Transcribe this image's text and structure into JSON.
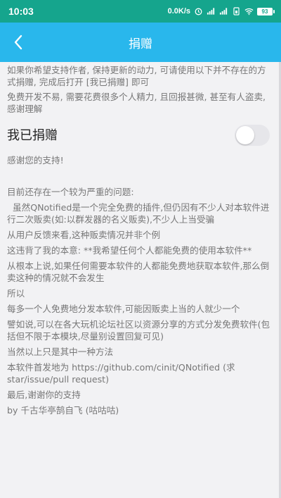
{
  "status_bar": {
    "time": "10:03",
    "speed": "0.0K/s",
    "battery": "93"
  },
  "app_bar": {
    "title": "捐赠",
    "back_icon": "chevron-left-icon"
  },
  "intro": [
    "如果你希望支持作者, 保持更新的动力, 可请使用以下并不存在的方式捐赠, 完成后打开 [我已捐赠] 即可",
    "免费开发不易, 需要花费很多个人精力, 且回报甚微, 甚至有人盗卖, 感谢理解"
  ],
  "toggle": {
    "label": "我已捐赠",
    "checked": false
  },
  "thanks": "感谢您的支持!",
  "paragraphs": [
    "目前还存在一个较为严重的问题:",
    "虽然QNotified是一个完全免费的插件,但仍因有不少人对本软件进行二次贩卖(如:以群发器的名义贩卖),不少人上当受骗",
    "从用户反馈来看,这种贩卖情况并非个例",
    "这违背了我的本意: **我希望任何个人都能免费的使用本软件**",
    "从根本上说,如果任何需要本软件的人都能免费地获取本软件,那么倒卖这种的情况就不会发生",
    "所以",
    "每多一个人免费地分发本软件,可能因贩卖上当的人就少一个",
    "譬如说,可以在各大玩机论坛社区以资源分享的方式分发免费软件(包括但不限于本模块,尽量别设置回复可见)",
    "当然以上只是其中一种方法",
    "本软件首发地为 https://github.com/cinit/QNotified (求star/issue/pull request)",
    "最后,谢谢你的支持",
    "by 千古华亭鹄自飞 (咕咕咕)"
  ],
  "colors": {
    "status_bar": "#15a58d",
    "app_bar": "#29b7ec",
    "background": "#f2f2f4"
  }
}
